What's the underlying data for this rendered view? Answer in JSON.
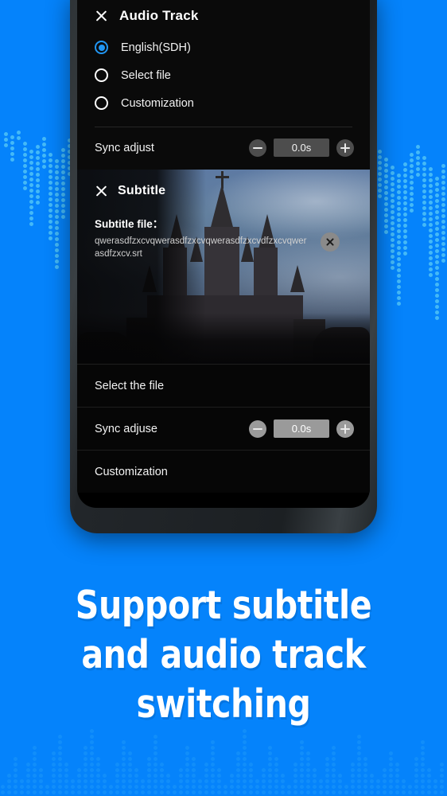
{
  "background": {
    "color": "#0583fb",
    "dot_color": "#4fc3f7"
  },
  "phone": {
    "audio_panel": {
      "close_icon": "close-icon",
      "title": "Audio Track",
      "options": [
        {
          "label": "English(SDH)",
          "selected": true
        },
        {
          "label": "Select file",
          "selected": false
        },
        {
          "label": "Customization",
          "selected": false
        }
      ],
      "sync": {
        "label": "Sync adjust",
        "minus_icon": "minus-icon",
        "value": "0.0s",
        "plus_icon": "plus-icon"
      }
    },
    "subtitle_panel": {
      "close_icon": "close-icon",
      "title": "Subtitle",
      "file_label": "Subtitle file：",
      "file_name": "qwerasdfzxcvqwerasdfzxcvqwerasdfzxcvdfzxcvqwerasdfzxcv.srt",
      "clear_icon": "clear-circle-icon",
      "rows": [
        {
          "label": "Select the file",
          "type": "plain"
        },
        {
          "label": "Sync adjuse",
          "type": "stepper",
          "minus_icon": "minus-icon",
          "value": "0.0s",
          "plus_icon": "plus-icon"
        },
        {
          "label": "Customization",
          "type": "plain"
        }
      ]
    }
  },
  "headline": {
    "line1": "Support subtitle",
    "line2": "and audio track",
    "line3": "switching"
  }
}
